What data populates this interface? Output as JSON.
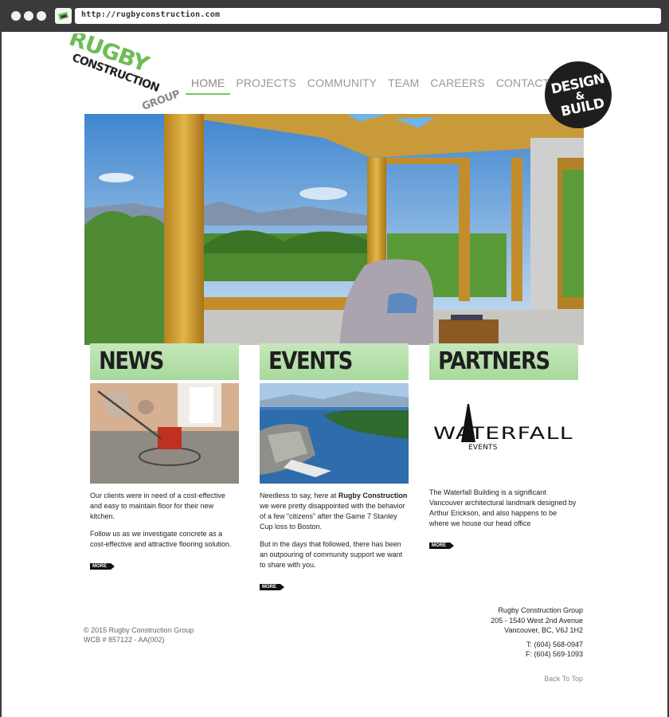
{
  "browser": {
    "url": "http://rugbyconstruction.com"
  },
  "logo": {
    "line1": "RUGBY",
    "line2": "CONSTRUCTION",
    "line3": "GROUP",
    "accent_color": "#6dbd55"
  },
  "nav": {
    "items": [
      {
        "label": "HOME",
        "active": true
      },
      {
        "label": "PROJECTS"
      },
      {
        "label": "COMMUNITY"
      },
      {
        "label": "TEAM"
      },
      {
        "label": "CAREERS"
      },
      {
        "label": "CONTACT"
      }
    ]
  },
  "badge": {
    "line1": "DESIGN",
    "line2": "&",
    "line3": "BUILD"
  },
  "columns": {
    "news": {
      "title": "NEWS",
      "p1": "Our clients were in need of a cost-effective and easy to maintain floor for their new kitchen.",
      "p2": "Follow us as we investigate concrete as a cost-effective and attractive flooring solution.",
      "more": "MORE"
    },
    "events": {
      "title": "EVENTS",
      "p1_pre": "Needless to say, here at ",
      "p1_bold": "Rugby Construction",
      "p1_post": " we were pretty disappointed with the behavior of a few “citizens” after the Game 7 Stanley Cup loss to Boston.",
      "p2": "But in the days that followed, there has been an outpouring of community support we want to share with you.",
      "more": "MORE"
    },
    "partners": {
      "title": "PARTNERS",
      "logo_main": "WATERFALL",
      "logo_sub": "EVENTS",
      "p1": "The Waterfall Building is a significant Vancouver architectural landmark designed by Arthur Erickson, and also happens to be where we house our head office",
      "more": "MORE"
    }
  },
  "footer": {
    "copyright": "© 2015 Rugby Construction Group",
    "wcb": "WCB # 857122 - AA(002)",
    "company": "Rugby Construction Group",
    "address1": "205 - 1540 West 2nd Avenue",
    "address2": "Vancouver, BC, V6J 1H2",
    "phone": "T: (604) 568-0947",
    "fax": "F: (604) 569-1093",
    "back_to_top": "Back To Top"
  },
  "colors": {
    "header_green": "#a7d99b",
    "nav_underline": "#7cc36a"
  }
}
